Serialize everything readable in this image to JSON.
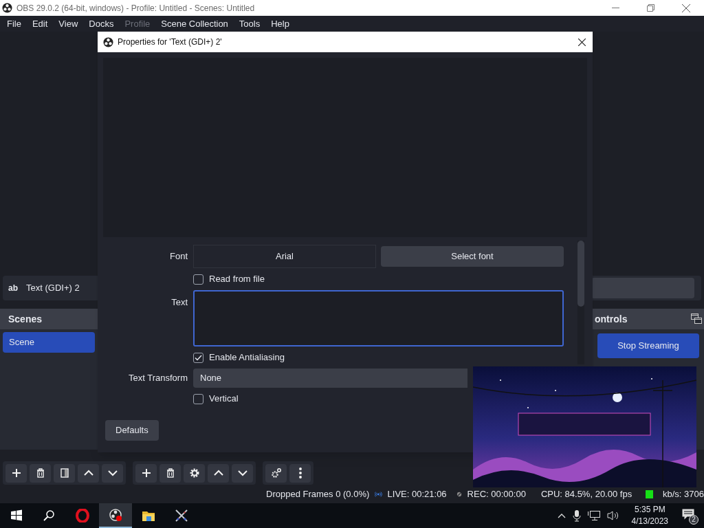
{
  "window": {
    "title": "OBS 29.0.2 (64-bit, windows) - Profile: Untitled - Scenes: Untitled"
  },
  "menu": [
    {
      "label": "File",
      "disabled": false
    },
    {
      "label": "Edit",
      "disabled": false
    },
    {
      "label": "View",
      "disabled": false
    },
    {
      "label": "Docks",
      "disabled": false
    },
    {
      "label": "Profile",
      "disabled": true
    },
    {
      "label": "Scene Collection",
      "disabled": false
    },
    {
      "label": "Tools",
      "disabled": false
    },
    {
      "label": "Help",
      "disabled": false
    }
  ],
  "source_bar": {
    "icon": "ab",
    "label": "Text (GDI+) 2"
  },
  "scenes": {
    "title": "Scenes",
    "items": [
      {
        "label": "Scene",
        "selected": true
      }
    ]
  },
  "controls": {
    "title": "ontrols",
    "button": "Stop Streaming"
  },
  "toolbar": [
    {
      "tools": [
        {
          "kind": "add"
        },
        {
          "kind": "remove"
        },
        {
          "kind": "filter"
        },
        {
          "kind": "up"
        },
        {
          "kind": "down"
        }
      ]
    },
    {
      "tools": [
        {
          "kind": "add"
        },
        {
          "kind": "remove"
        },
        {
          "kind": "gear"
        },
        {
          "kind": "up"
        },
        {
          "kind": "down"
        }
      ]
    },
    {
      "tools": [
        {
          "kind": "gears"
        },
        {
          "kind": "more"
        }
      ]
    }
  ],
  "status_bar": {
    "dropped_frames": "Dropped Frames 0 (0.0%)",
    "live": "LIVE: 00:21:06",
    "rec": "REC: 00:00:00",
    "cpu": "CPU: 84.5%, 20.00 fps",
    "kbps": "kb/s: 3706"
  },
  "dialog": {
    "title": "Properties for 'Text (GDI+) 2'",
    "properties": [
      {
        "kind": "font",
        "label": "Font",
        "value": "Arial",
        "button": "Select font"
      },
      {
        "kind": "checkbox",
        "label": "Read from file",
        "checked": false
      },
      {
        "kind": "textarea",
        "label": "Text"
      },
      {
        "kind": "checkbox",
        "label": "Enable Antialiasing",
        "checked": true
      },
      {
        "kind": "select",
        "label": "Text Transform",
        "value": "None"
      },
      {
        "kind": "checkbox",
        "label": "Vertical",
        "checked": false
      }
    ],
    "defaults_button": "Defaults"
  },
  "taskbar": {
    "apps": [
      {
        "kind": "start",
        "selected": false
      },
      {
        "kind": "search",
        "selected": false
      },
      {
        "kind": "opera",
        "selected": false
      },
      {
        "kind": "obs",
        "selected": true
      },
      {
        "kind": "folder",
        "selected": false
      },
      {
        "kind": "swords",
        "selected": false
      }
    ],
    "time": "5:35 PM",
    "date": "4/13/2023",
    "notifications": "2"
  }
}
